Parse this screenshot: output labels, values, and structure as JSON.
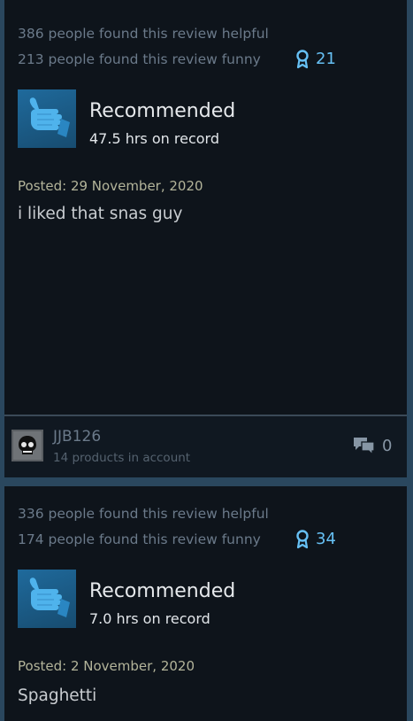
{
  "reviews": [
    {
      "helpful": "386 people found this review helpful",
      "funny": "213 people found this review funny",
      "award_count": "21",
      "award_icon": "award-ribbon-icon",
      "recommendation": "Recommended",
      "hours": "47.5 hrs on record",
      "posted": "Posted: 29 November, 2020",
      "content": "i liked that snas guy",
      "author": {
        "name": "JJB126",
        "products": "14 products in account"
      },
      "comment_count": "0"
    },
    {
      "helpful": "336 people found this review helpful",
      "funny": "174 people found this review funny",
      "award_count": "34",
      "award_icon": "award-ribbon-icon",
      "recommendation": "Recommended",
      "hours": "7.0 hrs on record",
      "posted": "Posted: 2 November, 2020",
      "content": "Spaghetti"
    }
  ],
  "colors": {
    "background": "#2a475e",
    "card": "#0e141b",
    "accent": "#66c0f4",
    "posted_text": "#b3b49a"
  }
}
